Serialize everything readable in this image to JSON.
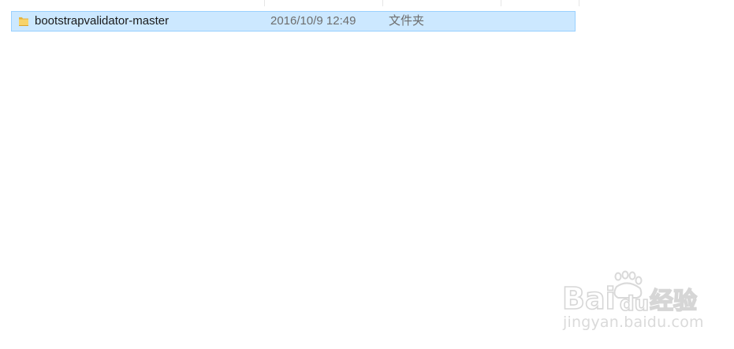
{
  "file_list": {
    "rows": [
      {
        "name": "bootstrapvalidator-master",
        "date_modified": "2016/10/9 12:49",
        "type": "文件夹",
        "icon": "folder-icon",
        "selected": true
      }
    ]
  },
  "colors": {
    "selection_bg": "#cce8ff",
    "selection_border": "#99d1ff",
    "folder": "#f4c95d"
  },
  "watermark": {
    "logo_text": "Bai du 经验",
    "url": "jingyan.baidu.com"
  }
}
